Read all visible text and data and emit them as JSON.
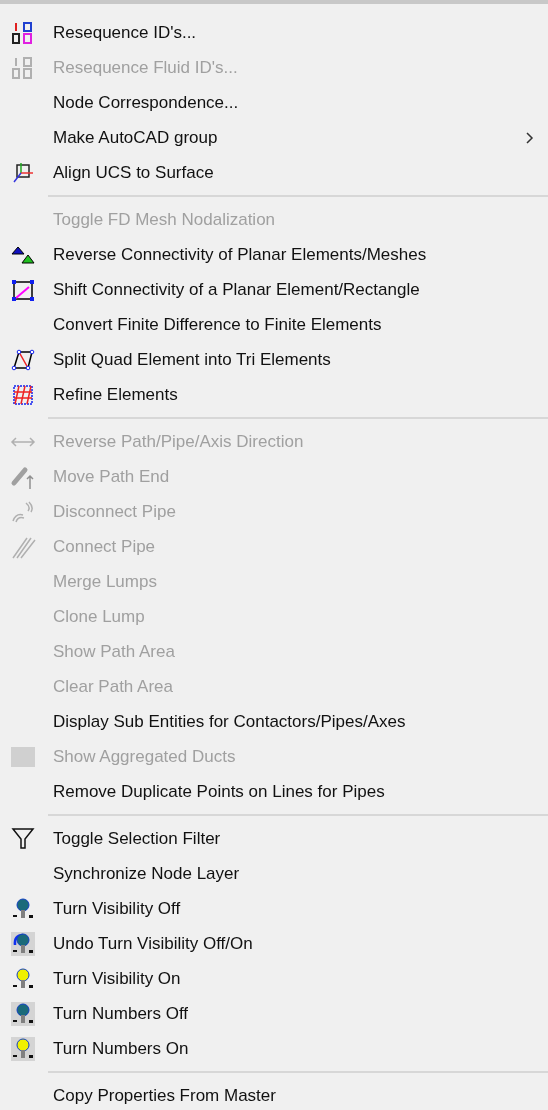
{
  "menu": {
    "items": [
      {
        "kind": "item",
        "label": "Resequence ID's...",
        "disabled": false,
        "submenu": false
      },
      {
        "kind": "item",
        "label": "Resequence Fluid ID's...",
        "disabled": true,
        "submenu": false
      },
      {
        "kind": "item",
        "label": "Node Correspondence...",
        "disabled": false,
        "submenu": false
      },
      {
        "kind": "item",
        "label": "Make AutoCAD group",
        "disabled": false,
        "submenu": true
      },
      {
        "kind": "item",
        "label": "Align UCS to Surface",
        "disabled": false,
        "submenu": false
      },
      {
        "kind": "separator"
      },
      {
        "kind": "item",
        "label": "Toggle FD Mesh Nodalization",
        "disabled": true,
        "submenu": false
      },
      {
        "kind": "item",
        "label": "Reverse Connectivity of Planar Elements/Meshes",
        "disabled": false,
        "submenu": false
      },
      {
        "kind": "item",
        "label": "Shift Connectivity of a Planar Element/Rectangle",
        "disabled": false,
        "submenu": false
      },
      {
        "kind": "item",
        "label": "Convert Finite Difference to Finite Elements",
        "disabled": false,
        "submenu": false
      },
      {
        "kind": "item",
        "label": "Split Quad Element into Tri Elements",
        "disabled": false,
        "submenu": false
      },
      {
        "kind": "item",
        "label": "Refine Elements",
        "disabled": false,
        "submenu": false
      },
      {
        "kind": "separator"
      },
      {
        "kind": "item",
        "label": "Reverse Path/Pipe/Axis Direction",
        "disabled": true,
        "submenu": false
      },
      {
        "kind": "item",
        "label": "Move Path End",
        "disabled": true,
        "submenu": false
      },
      {
        "kind": "item",
        "label": "Disconnect Pipe",
        "disabled": true,
        "submenu": false
      },
      {
        "kind": "item",
        "label": "Connect Pipe",
        "disabled": true,
        "submenu": false
      },
      {
        "kind": "item",
        "label": "Merge Lumps",
        "disabled": true,
        "submenu": false
      },
      {
        "kind": "item",
        "label": "Clone Lump",
        "disabled": true,
        "submenu": false
      },
      {
        "kind": "item",
        "label": "Show Path Area",
        "disabled": true,
        "submenu": false
      },
      {
        "kind": "item",
        "label": "Clear Path Area",
        "disabled": true,
        "submenu": false
      },
      {
        "kind": "item",
        "label": "Display Sub Entities for Contactors/Pipes/Axes",
        "disabled": false,
        "submenu": false
      },
      {
        "kind": "item",
        "label": "Show Aggregated Ducts",
        "disabled": true,
        "submenu": false
      },
      {
        "kind": "item",
        "label": "Remove Duplicate Points on Lines for Pipes",
        "disabled": false,
        "submenu": false
      },
      {
        "kind": "separator"
      },
      {
        "kind": "item",
        "label": "Toggle Selection Filter",
        "disabled": false,
        "submenu": false
      },
      {
        "kind": "item",
        "label": "Synchronize Node Layer",
        "disabled": false,
        "submenu": false
      },
      {
        "kind": "item",
        "label": "Turn Visibility Off",
        "disabled": false,
        "submenu": false
      },
      {
        "kind": "item",
        "label": "Undo Turn Visibility Off/On",
        "disabled": false,
        "submenu": false
      },
      {
        "kind": "item",
        "label": "Turn Visibility On",
        "disabled": false,
        "submenu": false
      },
      {
        "kind": "item",
        "label": "Turn Numbers Off",
        "disabled": false,
        "submenu": false
      },
      {
        "kind": "item",
        "label": "Turn Numbers On",
        "disabled": false,
        "submenu": false
      },
      {
        "kind": "separator"
      },
      {
        "kind": "item",
        "label": "Copy Properties From Master",
        "disabled": false,
        "submenu": false
      }
    ]
  }
}
